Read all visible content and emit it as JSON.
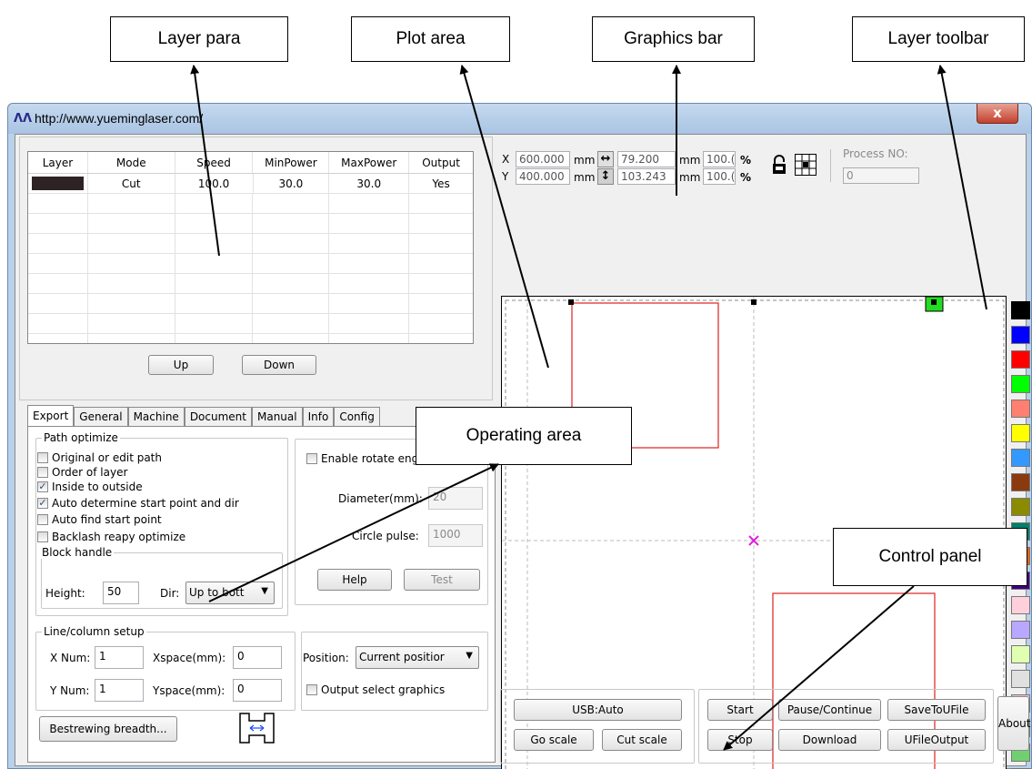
{
  "callouts": {
    "layer_para": "Layer para",
    "plot_area": "Plot area",
    "graphics_bar": "Graphics bar",
    "layer_toolbar": "Layer toolbar",
    "operating_area": "Operating area",
    "control_panel": "Control panel"
  },
  "window": {
    "title": "http://www.yueminglaser.com/",
    "close_label": "x"
  },
  "layer_table": {
    "headers": [
      "Layer",
      "Mode",
      "Speed",
      "MinPower",
      "MaxPower",
      "Output"
    ],
    "rows": [
      {
        "color": "#2d2324",
        "mode": "Cut",
        "speed": "100.0",
        "min_power": "30.0",
        "max_power": "30.0",
        "output": "Yes"
      }
    ],
    "up_label": "Up",
    "down_label": "Down"
  },
  "tabs": [
    "Export",
    "General",
    "Machine",
    "Document",
    "Manual",
    "Info",
    "Config"
  ],
  "export": {
    "path_optimize_title": "Path optimize",
    "options": [
      {
        "label": "Original or edit path",
        "checked": false
      },
      {
        "label": "Order of layer",
        "checked": false
      },
      {
        "label": "Inside to outside",
        "checked": true
      },
      {
        "label": "Auto determine start point and dir",
        "checked": true
      },
      {
        "label": "Auto find start point",
        "checked": false
      },
      {
        "label": "Backlash reapy optimize",
        "checked": false
      }
    ],
    "block_handle_title": "Block handle",
    "height_label": "Height:",
    "height_value": "50",
    "dir_label": "Dir:",
    "dir_value": "Up to bott",
    "rotate_label": "Enable rotate engr",
    "diameter_label": "Diameter(mm):",
    "diameter_value": "20",
    "circle_pulse_label": "Circle pulse:",
    "circle_pulse_value": "1000",
    "help_label": "Help",
    "test_label": "Test",
    "line_column_title": "Line/column setup",
    "xnum_label": "X Num:",
    "xnum_value": "1",
    "xspace_label": "Xspace(mm):",
    "xspace_value": "0",
    "ynum_label": "Y Num:",
    "ynum_value": "1",
    "yspace_label": "Yspace(mm):",
    "yspace_value": "0",
    "bestrewing_label": "Bestrewing breadth...",
    "position_label": "Position:",
    "position_value": "Current positior",
    "output_select_label": "Output select graphics"
  },
  "coords": {
    "x_label": "X",
    "y_label": "Y",
    "x_value": "600.000",
    "y_value": "400.000",
    "unit": "mm",
    "width_value": "79.200",
    "height_value": "103.243",
    "scale_x": "100.(",
    "scale_y": "100.(",
    "percent": "%",
    "process_label": "Process NO:",
    "process_value": "0"
  },
  "palette_colors": [
    "#000000",
    "#0000ff",
    "#ff0000",
    "#00ff00",
    "#ff8070",
    "#ffff00",
    "#3399ff",
    "#8b3a10",
    "#8b8b00",
    "#00806a",
    "#ff6600",
    "#400080",
    "#ffd0dc",
    "#b8a8ff",
    "#e0ffb0",
    "#e0e0e0",
    "#f0c0d0",
    "#8080e0",
    "#70d070",
    "#b8a078"
  ],
  "controls": {
    "usb_label": "USB:Auto",
    "go_scale_label": "Go scale",
    "cut_scale_label": "Cut scale",
    "start_label": "Start",
    "stop_label": "Stop",
    "pause_label": "Pause/Continue",
    "download_label": "Download",
    "save_ufile_label": "SaveToUFile",
    "ufile_output_label": "UFileOutput",
    "about_label": "About"
  }
}
